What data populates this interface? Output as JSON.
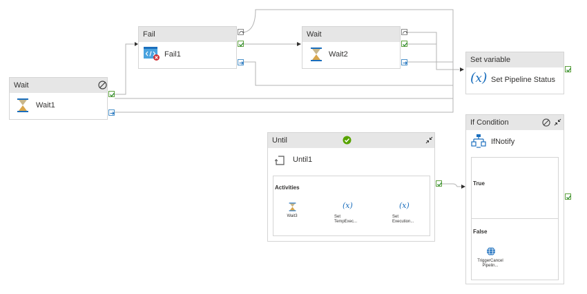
{
  "wait1": {
    "header": "Wait",
    "name": "Wait1"
  },
  "fail1": {
    "header": "Fail",
    "name": "Fail1"
  },
  "wait2": {
    "header": "Wait",
    "name": "Wait2"
  },
  "setvar": {
    "header": "Set variable",
    "name": "Set Pipeline Status"
  },
  "until": {
    "header": "Until",
    "name": "Until1",
    "section": "Activities",
    "items": [
      {
        "label": "Wait3"
      },
      {
        "label": "Set TempExec..."
      },
      {
        "label": "Set Execution..."
      }
    ]
  },
  "ifcond": {
    "header": "If Condition",
    "name": "IfNotify",
    "true_label": "True",
    "false_label": "False",
    "false_item": "TriggerCancelPipelin..."
  },
  "colors": {
    "success": "#57a300",
    "accent": "#0078d4",
    "header_bg": "#e6e6e6"
  }
}
